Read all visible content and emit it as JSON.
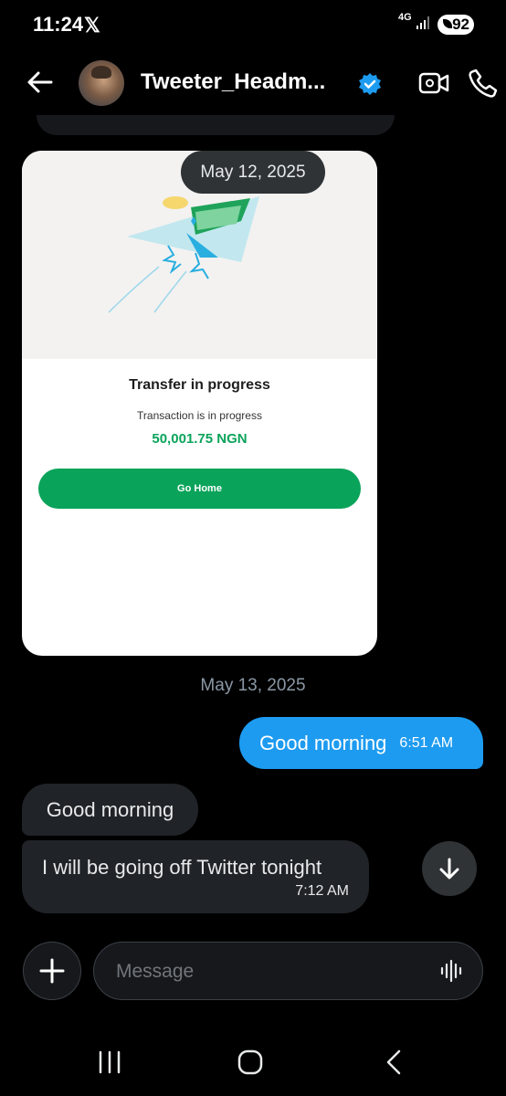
{
  "status_bar": {
    "time": "11:24",
    "x_logo": "𝕏",
    "network": "4G",
    "battery": "92"
  },
  "header": {
    "name": "Tweeter_Headm..."
  },
  "date_pill": "May 12, 2025",
  "card": {
    "title": "Transfer in progress",
    "subtitle": "Transaction is in progress",
    "amount": "50,001.75 NGN",
    "button_label": "Go Home",
    "accent_color": "#0aa35a"
  },
  "date_separator": "May 13, 2025",
  "messages": [
    {
      "direction": "outgoing",
      "text": "Good morning",
      "time": "6:51 AM"
    },
    {
      "direction": "incoming",
      "text": "Good morning"
    },
    {
      "direction": "incoming",
      "text": "I will be going off Twitter tonight",
      "time": "7:12 AM"
    }
  ],
  "composer": {
    "placeholder": "Message"
  },
  "colors": {
    "background": "#000000",
    "outgoing_bubble": "#1d9bf0",
    "incoming_bubble": "#202327",
    "verified_badge": "#1d9bf0"
  },
  "icons": {
    "back": "arrow-left-icon",
    "verified": "verified-badge-icon",
    "video": "video-camera-icon",
    "call": "phone-icon",
    "scroll_down": "arrow-down-icon",
    "add": "plus-icon",
    "voice": "voice-wave-icon",
    "nav_recents": "recents-icon",
    "nav_home": "home-icon",
    "nav_back": "chevron-left-icon"
  }
}
